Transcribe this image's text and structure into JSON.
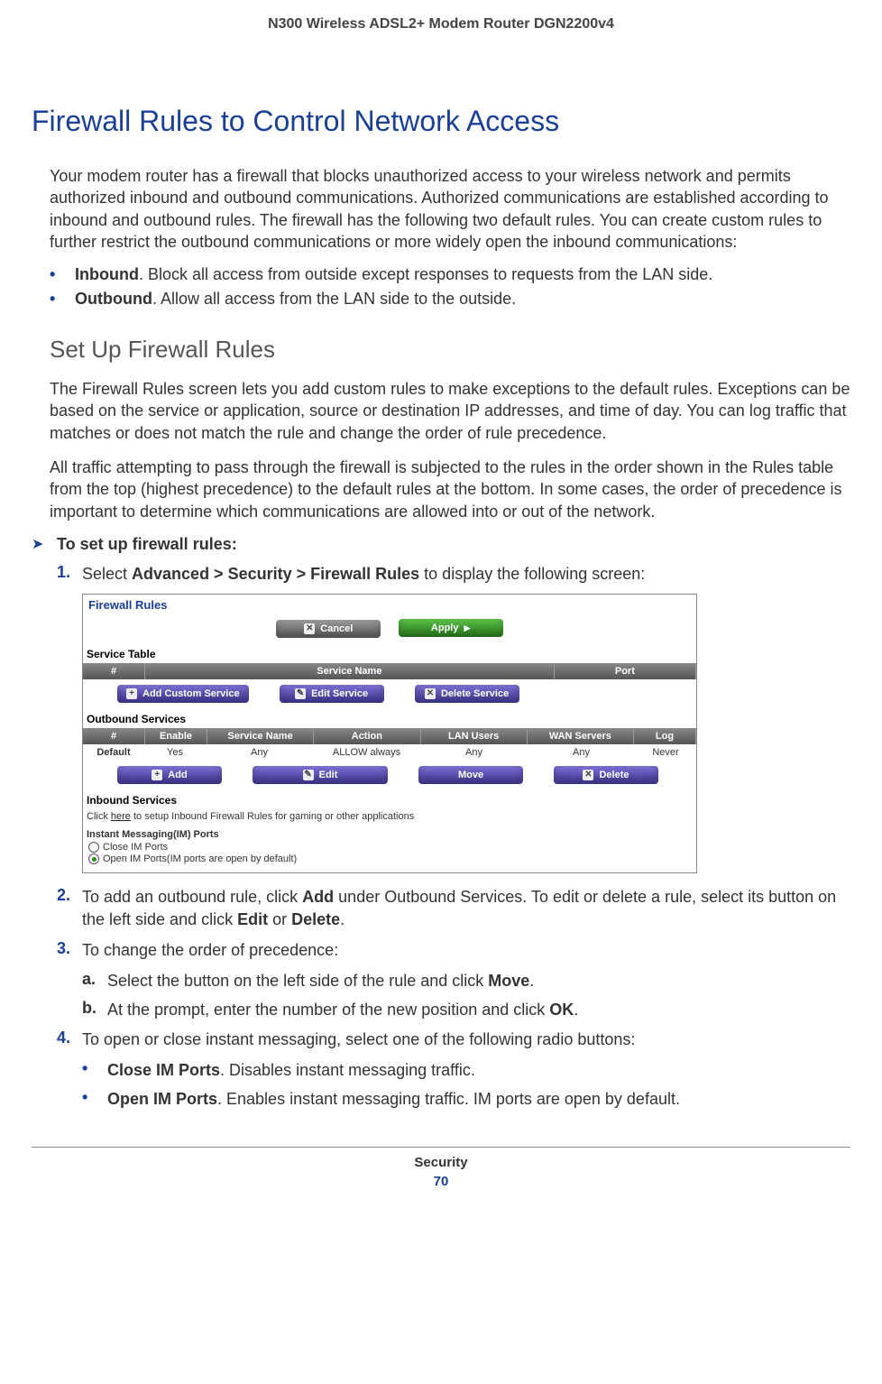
{
  "header": "N300 Wireless ADSL2+ Modem Router DGN2200v4",
  "title": "Firewall Rules to Control Network Access",
  "intro": "Your modem router has a firewall that blocks unauthorized access to your wireless network and permits authorized inbound and outbound communications. Authorized communications are established according to inbound and outbound rules. The firewall has the following two default rules. You can create custom rules to further restrict the outbound communications or more widely open the inbound communications:",
  "bullets": {
    "b1_bold": "Inbound",
    "b1_text": ". Block all access from outside except responses to requests from the LAN side.",
    "b2_bold": "Outbound",
    "b2_text": ". Allow all access from the LAN side to the outside."
  },
  "subsection": {
    "title": "Set Up Firewall Rules",
    "p1": "The Firewall Rules screen lets you add custom rules to make exceptions to the default rules. Exceptions can be based on the service or application, source or destination IP addresses, and time of day. You can log traffic that matches or does not match the rule and change the order of rule precedence.",
    "p2": "All traffic attempting to pass through the firewall is subjected to the rules in the order shown in the Rules table from the top (highest precedence) to the default rules at the bottom. In some cases, the order of precedence is important to determine which communications are allowed into or out of the network."
  },
  "task_label": "To set up firewall rules:",
  "steps": {
    "s1_pre": "Select ",
    "s1_bold": "Advanced > Security > Firewall Rules",
    "s1_post": " to display the following screen:",
    "s2_a": "To add an outbound rule, click ",
    "s2_b": "Add",
    "s2_c": " under Outbound Services. To edit or delete a rule, select its button on the left side and click ",
    "s2_d": "Edit",
    "s2_e": " or ",
    "s2_f": "Delete",
    "s2_g": ".",
    "s3": "To change the order of precedence:",
    "s3a_pre": "Select the button on the left side of the rule and click ",
    "s3a_bold": "Move",
    "s3a_post": ".",
    "s3b_pre": "At the prompt, enter the number of the new position and click ",
    "s3b_bold": "OK",
    "s3b_post": ".",
    "s4": "To open or close instant messaging, select one of the following radio buttons:",
    "s4a_bold": "Close IM Ports",
    "s4a_text": ". Disables instant messaging traffic.",
    "s4b_bold": "Open IM Ports",
    "s4b_text": ". Enables instant messaging traffic. IM ports are open by default."
  },
  "screenshot": {
    "title": "Firewall Rules",
    "cancel": "Cancel",
    "apply": "Apply",
    "service_table": "Service Table",
    "col_num": "#",
    "col_service_name": "Service Name",
    "col_port": "Port",
    "add_custom": "Add Custom Service",
    "edit_service": "Edit Service",
    "delete_service": "Delete Service",
    "outbound": "Outbound Services",
    "col_enable": "Enable",
    "col_action": "Action",
    "col_lan": "LAN Users",
    "col_wan": "WAN Servers",
    "col_log": "Log",
    "row_default": "Default",
    "row_yes": "Yes",
    "row_any": "Any",
    "row_allow": "ALLOW always",
    "row_never": "Never",
    "add": "Add",
    "edit": "Edit",
    "move": "Move",
    "delete": "Delete",
    "inbound": "Inbound Services",
    "inbound_pre": "Click ",
    "inbound_link": "here",
    "inbound_post": " to setup Inbound Firewall Rules for gaming or other applications",
    "im_title": "Instant Messaging(IM) Ports",
    "im_close": "Close IM Ports",
    "im_open": "Open IM Ports(IM ports are open by default)"
  },
  "footer": {
    "section": "Security",
    "page": "70"
  }
}
